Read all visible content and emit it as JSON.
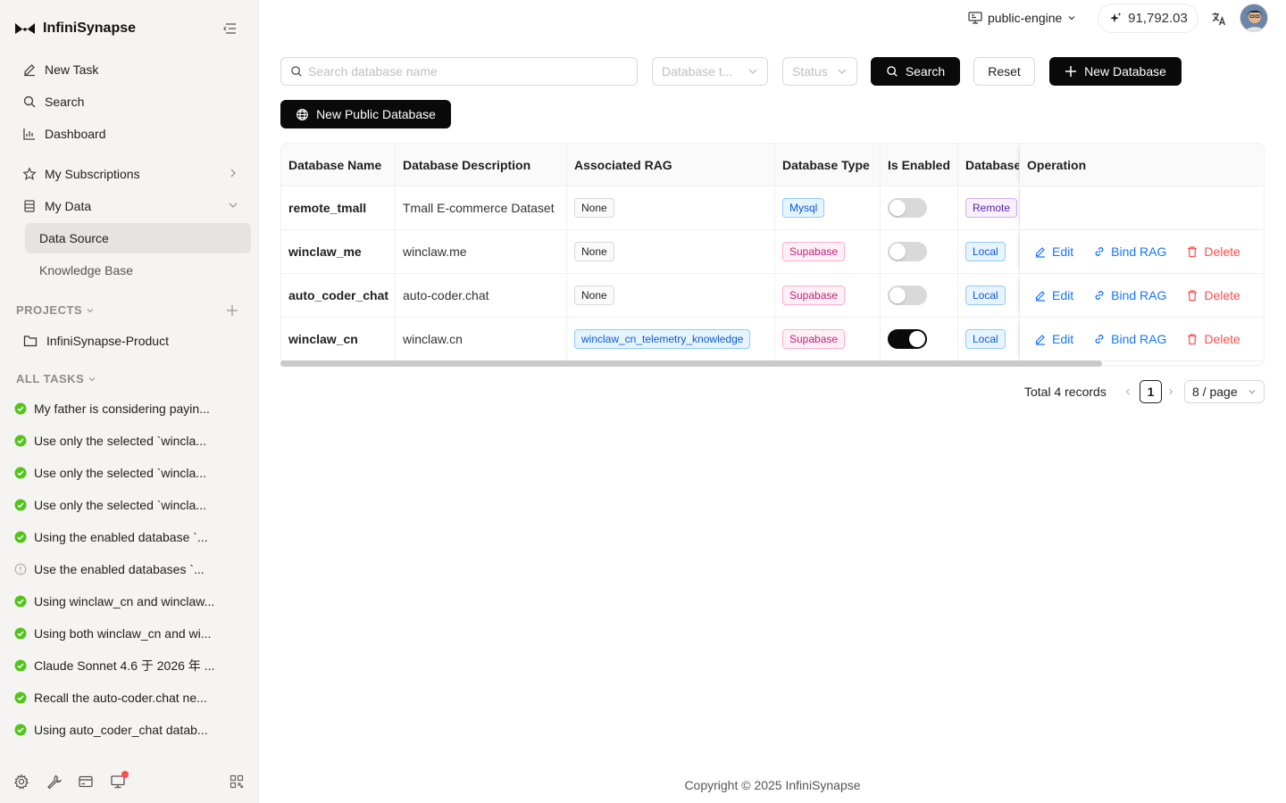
{
  "app": {
    "name": "InfiniSynapse",
    "engine": "public-engine",
    "credits": "91,792.03"
  },
  "sidebar": {
    "nav": [
      {
        "label": "New Task",
        "icon": "edit-icon"
      },
      {
        "label": "Search",
        "icon": "search-icon"
      },
      {
        "label": "Dashboard",
        "icon": "chart-icon"
      },
      {
        "label": "My Subscriptions",
        "icon": "star-icon"
      },
      {
        "label": "My Data",
        "icon": "database-icon"
      }
    ],
    "sub_items": [
      {
        "label": "Data Source",
        "active": true
      },
      {
        "label": "Knowledge Base",
        "active": false
      }
    ],
    "projects_header": "PROJECTS",
    "projects": [
      {
        "label": "InfiniSynapse-Product"
      }
    ],
    "tasks_header": "ALL TASKS",
    "tasks": [
      {
        "label": "My father is considering payin...",
        "status": "done"
      },
      {
        "label": "Use only the selected `wincla...",
        "status": "done"
      },
      {
        "label": "Use only the selected `wincla...",
        "status": "done"
      },
      {
        "label": "Use only the selected `wincla...",
        "status": "done"
      },
      {
        "label": "Using the enabled database `...",
        "status": "done"
      },
      {
        "label": "Use the enabled databases `...",
        "status": "pending"
      },
      {
        "label": "Using winclaw_cn and winclaw...",
        "status": "done"
      },
      {
        "label": "Using both winclaw_cn and wi...",
        "status": "done"
      },
      {
        "label": "Claude Sonnet 4.6 于 2026 年 ...",
        "status": "done"
      },
      {
        "label": "Recall the auto-coder.chat ne...",
        "status": "done"
      },
      {
        "label": "Using auto_coder_chat datab...",
        "status": "done"
      }
    ]
  },
  "filters": {
    "search_placeholder": "Search database name",
    "db_type_placeholder": "Database t...",
    "status_placeholder": "Status",
    "search_btn": "Search",
    "reset_btn": "Reset",
    "new_db_btn": "New Database",
    "new_public_db_btn": "New Public Database"
  },
  "table": {
    "headers": [
      "Database Name",
      "Database Description",
      "Associated RAG",
      "Database Type",
      "Is Enabled",
      "Database",
      "Operation"
    ],
    "rows": [
      {
        "name": "remote_tmall",
        "desc": "Tmall E-commerce Dataset",
        "rag": "None",
        "rag_style": "gray",
        "type": "Mysql",
        "type_style": "blue",
        "enabled": false,
        "source": "Remote",
        "source_style": "purple",
        "ops": false
      },
      {
        "name": "winclaw_me",
        "desc": "winclaw.me",
        "rag": "None",
        "rag_style": "gray",
        "type": "Supabase",
        "type_style": "pink",
        "enabled": false,
        "source": "Local",
        "source_style": "blue",
        "ops": true
      },
      {
        "name": "auto_coder_chat",
        "desc": "auto-coder.chat",
        "rag": "None",
        "rag_style": "gray",
        "type": "Supabase",
        "type_style": "pink",
        "enabled": false,
        "source": "Local",
        "source_style": "blue",
        "ops": true
      },
      {
        "name": "winclaw_cn",
        "desc": "winclaw.cn",
        "rag": "winclaw_cn_telemetry_knowledge",
        "rag_style": "blue",
        "type": "Supabase",
        "type_style": "pink",
        "enabled": true,
        "source": "Local",
        "source_style": "blue",
        "ops": true
      }
    ],
    "op_labels": {
      "edit": "Edit",
      "bind": "Bind RAG",
      "delete": "Delete"
    }
  },
  "pagination": {
    "total": "Total 4 records",
    "current": "1",
    "page_size": "8 / page"
  },
  "footer": "Copyright © 2025 InfiniSynapse",
  "colors": {
    "primary": "#0a0a0a",
    "link": "#1677ff",
    "danger": "#ff4d4f",
    "success": "#52c41a"
  }
}
